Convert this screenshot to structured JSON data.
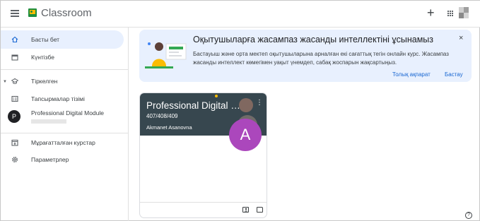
{
  "header": {
    "app_title": "Classroom",
    "add_label": "+"
  },
  "sidebar": {
    "items": [
      {
        "label": "Басты бет",
        "icon": "home-icon"
      },
      {
        "label": "Күнтізбе",
        "icon": "calendar-icon"
      },
      {
        "label": "Тіркелген",
        "icon": "enrolled-icon"
      },
      {
        "label": "Тапсырмалар тізімі",
        "icon": "todo-icon"
      },
      {
        "label": "Professional Digital Module",
        "initial": "P"
      },
      {
        "label": "Мұрағатталған курстар",
        "icon": "archive-icon"
      },
      {
        "label": "Параметрлер",
        "icon": "gear-icon"
      }
    ]
  },
  "banner": {
    "title": "Оқытушыларға жасампаз жасанды интеллектіні ұсынамыз",
    "text": "Бастауыш және орта мектеп оқытушыларына арналған екі сағаттық тегін онлайн курс. Жасампаз жасанды интеллект көмегімен уақыт үнемдеп, сабақ жоспарын жақсартыңыз.",
    "learn_more": "Толық ақпарат",
    "start": "Бастау",
    "close": "×"
  },
  "course_card": {
    "title": "Professional Digital Module",
    "section": "407/408/409",
    "teacher": "Akmanet Asanovna",
    "avatar_letter": "A",
    "header_color": "#37474f",
    "avatar_color": "#ab47bc"
  },
  "help": "?"
}
